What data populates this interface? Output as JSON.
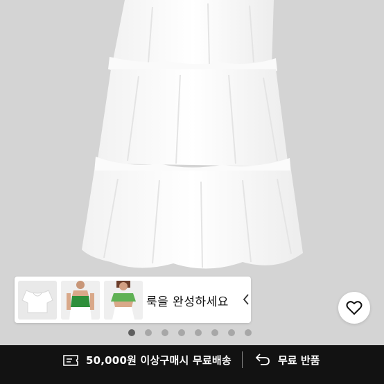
{
  "look_strip": {
    "label": "룩을 완성하세요",
    "items": [
      {
        "icon": "white-top-thumbnail"
      },
      {
        "icon": "green-halter-top-thumbnail"
      },
      {
        "icon": "green-crop-top-thumbnail"
      }
    ]
  },
  "carousel": {
    "total": 8,
    "active": 1
  },
  "wishlist": {
    "icon": "heart-outline-icon"
  },
  "footer": {
    "shipping_text": "50,000원 이상구매시 무료배송",
    "return_text": "무료 반품"
  },
  "colors": {
    "page_bg": "#d4d4d4",
    "footer_bg": "#121212",
    "dot_active": "#5f5f5f",
    "dot_inactive": "#a7a7a7"
  }
}
